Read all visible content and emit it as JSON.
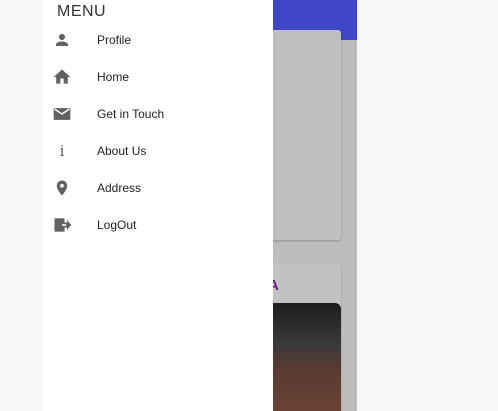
{
  "drawer": {
    "title": "MENU",
    "items": [
      {
        "label": "Profile",
        "icon": "person-icon"
      },
      {
        "label": "Home",
        "icon": "home-icon"
      },
      {
        "label": "Get in Touch",
        "icon": "mail-icon"
      },
      {
        "label": "About Us",
        "icon": "info-icon"
      },
      {
        "label": "Address",
        "icon": "location-pin-icon"
      },
      {
        "label": "LogOut",
        "icon": "logout-icon"
      }
    ]
  },
  "background": {
    "card_title_fragment": "A"
  },
  "colors": {
    "appbar": "#3f47c6",
    "icon": "#616161",
    "accent_title": "#6a1a8a"
  }
}
